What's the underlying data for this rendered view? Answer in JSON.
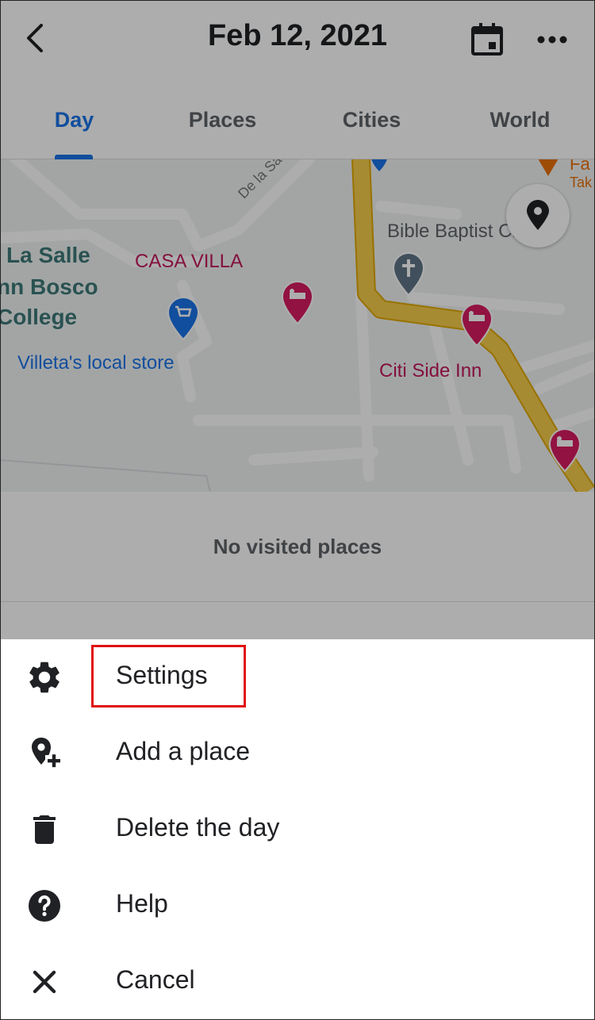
{
  "header": {
    "title": "Feb 12, 2021",
    "back_icon": "arrow-back-icon",
    "calendar_icon": "calendar-icon",
    "more_icon": "more-horiz-icon"
  },
  "tabs": [
    {
      "label": "Day",
      "active": true
    },
    {
      "label": "Places",
      "active": false
    },
    {
      "label": "Cities",
      "active": false
    },
    {
      "label": "World",
      "active": false
    }
  ],
  "map": {
    "labels": {
      "la_salle_1": "La Salle",
      "la_salle_2": "nn Bosco",
      "la_salle_3": "College",
      "casa_villa": "CASA VILLA",
      "villeta": "Villeta's local store",
      "church": "Bible Baptist Church",
      "citi_side": "Citi Side Inn",
      "road": "De la Salle D",
      "fa": "Fa",
      "tak": "Tak"
    },
    "colors": {
      "road": "#f6cd4c",
      "hotel_pin": "#d81b60",
      "store_pin": "#1a73e8",
      "church_pin": "#5f7586"
    }
  },
  "visited": {
    "text": "No visited places"
  },
  "menu": [
    {
      "label": "Settings",
      "icon": "gear-icon",
      "highlighted": true
    },
    {
      "label": "Add a place",
      "icon": "add-location-icon"
    },
    {
      "label": "Delete the day",
      "icon": "trash-icon"
    },
    {
      "label": "Help",
      "icon": "help-icon"
    },
    {
      "label": "Cancel",
      "icon": "close-icon"
    }
  ]
}
